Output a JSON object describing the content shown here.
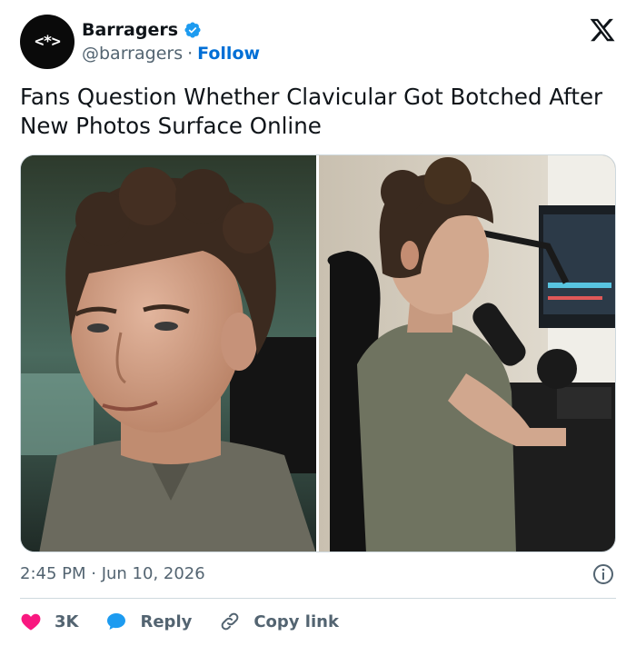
{
  "author": {
    "avatar_text": "<*>",
    "name": "Barragers",
    "handle": "@barragers",
    "separator": "·",
    "follow_label": "Follow"
  },
  "post": {
    "text": "Fans Question Whether Clavicular Got Botched After New Photos Surface Online",
    "timestamp": "2:45 PM · Jun 10, 2026"
  },
  "media": {
    "description_icon": "photo-collage"
  },
  "actions": {
    "likes_count": "3K",
    "reply_label": "Reply",
    "copy_link_label": "Copy link"
  },
  "colors": {
    "link_blue": "#006fd6",
    "like_red": "#f91880",
    "reply_blue": "#1d9bf0",
    "muted": "#536471"
  },
  "icons": {
    "verified": "verified-badge-icon",
    "x_logo": "x-logo-icon",
    "info": "info-icon",
    "heart": "heart-icon",
    "reply": "speech-bubble-icon",
    "link": "link-icon"
  }
}
